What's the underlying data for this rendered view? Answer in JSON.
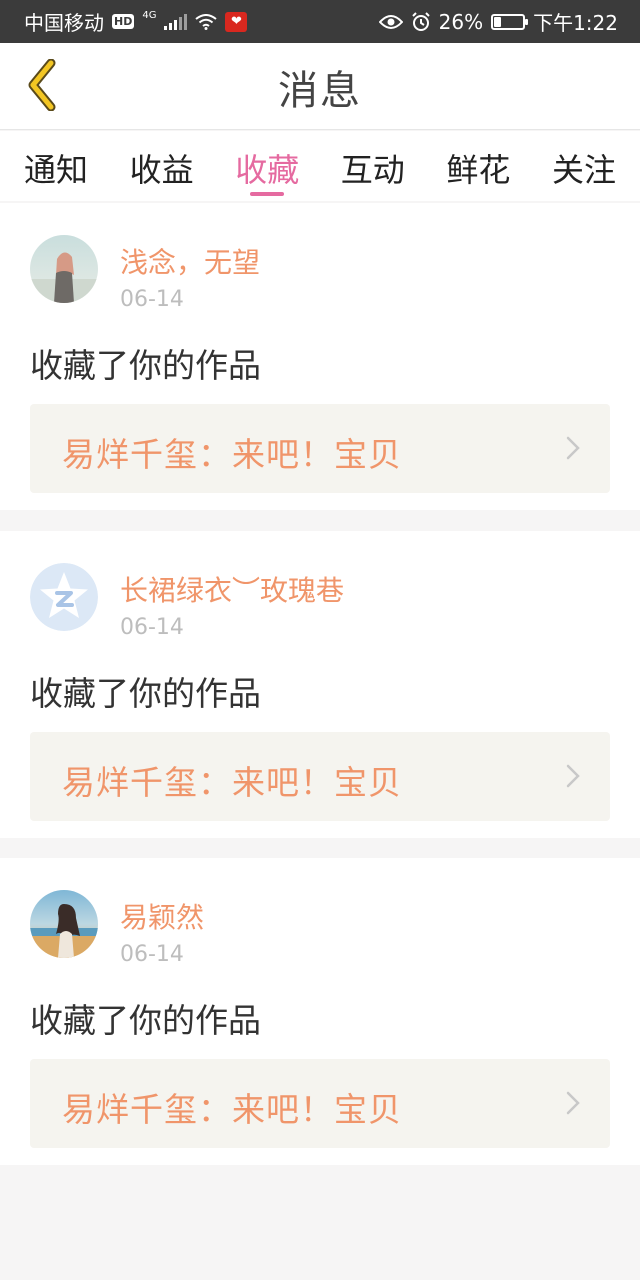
{
  "status_bar": {
    "carrier": "中国移动",
    "hd": "HD",
    "network": "4G",
    "battery_percent": "26%",
    "battery_level": 0.26,
    "time": "下午1:22",
    "icons": [
      "signal-icon",
      "wifi-icon",
      "app-notification-icon",
      "eye-icon",
      "alarm-icon",
      "battery-icon"
    ]
  },
  "header": {
    "title": "消息",
    "back_icon": "chevron-left-icon"
  },
  "tabs": [
    {
      "label": "通知",
      "active": false
    },
    {
      "label": "收益",
      "active": false
    },
    {
      "label": "收藏",
      "active": true
    },
    {
      "label": "互动",
      "active": false
    },
    {
      "label": "鲜花",
      "active": false
    },
    {
      "label": "关注",
      "active": false
    }
  ],
  "feed": [
    {
      "username": "浅念，无望",
      "date": "06-14",
      "action": "收藏了你的作品",
      "work_title": "易烊千玺：来吧！宝贝",
      "avatar": "photo-avatar"
    },
    {
      "username": "长裙绿衣︶玫瑰巷",
      "date": "06-14",
      "action": "收藏了你的作品",
      "work_title": "易烊千玺：来吧！宝贝",
      "avatar": "default-star-avatar"
    },
    {
      "username": "易颖然",
      "date": "06-14",
      "action": "收藏了你的作品",
      "work_title": "易烊千玺：来吧！宝贝",
      "avatar": "photo-avatar"
    }
  ],
  "colors": {
    "accent_pink": "#e56aa0",
    "username_orange": "#f0956a",
    "back_arrow_yellow": "#f3c623",
    "card_link_bg": "#f5f4ef"
  }
}
